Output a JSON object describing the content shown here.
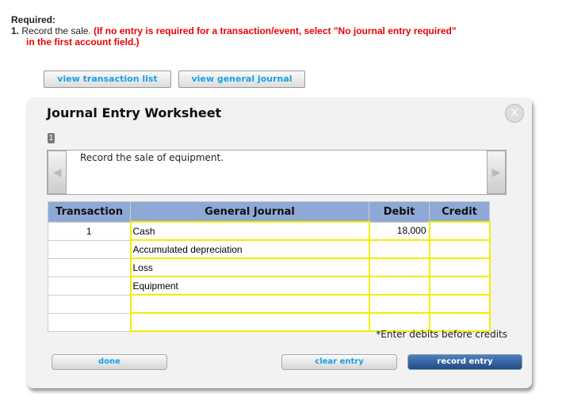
{
  "required": {
    "heading": "Required:",
    "number": "1.",
    "task": "Record the sale.",
    "instruction": "(If no entry is required for a transaction/event, select \"No journal entry required\"",
    "instruction2": "in the first account field.)"
  },
  "top_buttons": {
    "transactions": "view transaction list",
    "journal": "view general journal"
  },
  "worksheet": {
    "title": "Journal Entry Worksheet",
    "close": "X",
    "page": "1",
    "description": "Record the sale of equipment.",
    "columns": [
      "Transaction",
      "General Journal",
      "Debit",
      "Credit"
    ],
    "rows": [
      {
        "transaction": "1",
        "account": "Cash",
        "debit": "18,000",
        "credit": ""
      },
      {
        "transaction": "",
        "account": "Accumulated depreciation",
        "debit": "",
        "credit": ""
      },
      {
        "transaction": "",
        "account": "Loss",
        "debit": "",
        "credit": ""
      },
      {
        "transaction": "",
        "account": "Equipment",
        "debit": "",
        "credit": ""
      },
      {
        "transaction": "",
        "account": "",
        "debit": "",
        "credit": ""
      },
      {
        "transaction": "",
        "account": "",
        "debit": "",
        "credit": ""
      }
    ],
    "note": "*Enter debits before credits",
    "buttons": {
      "done": "done",
      "clear": "clear entry",
      "record": "record entry"
    }
  }
}
